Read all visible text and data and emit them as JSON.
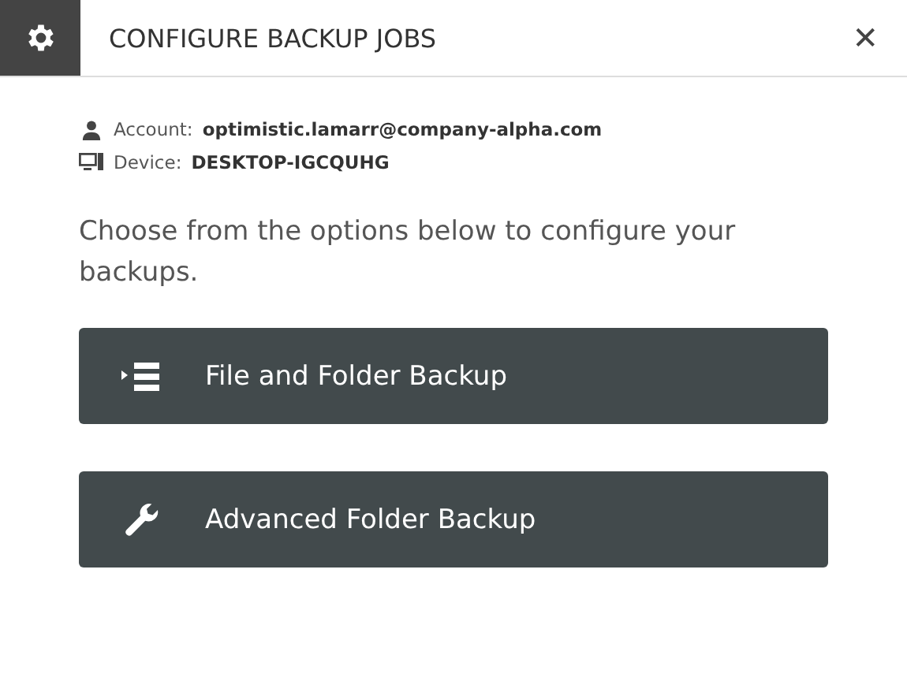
{
  "window": {
    "title": "CONFIGURE BACKUP JOBS",
    "close": "✕"
  },
  "info": [
    {
      "kind": "account",
      "label": "Account:",
      "value": "optimistic.lamarr@company-alpha.com"
    },
    {
      "kind": "device",
      "label": "Device:",
      "value": "DESKTOP-IGCQUHG"
    }
  ],
  "instruction": "Choose from the options below to configure your backups.",
  "options": [
    {
      "kind": "list",
      "label": "File and Folder Backup"
    },
    {
      "kind": "wrench",
      "label": "Advanced Folder Backup"
    }
  ]
}
